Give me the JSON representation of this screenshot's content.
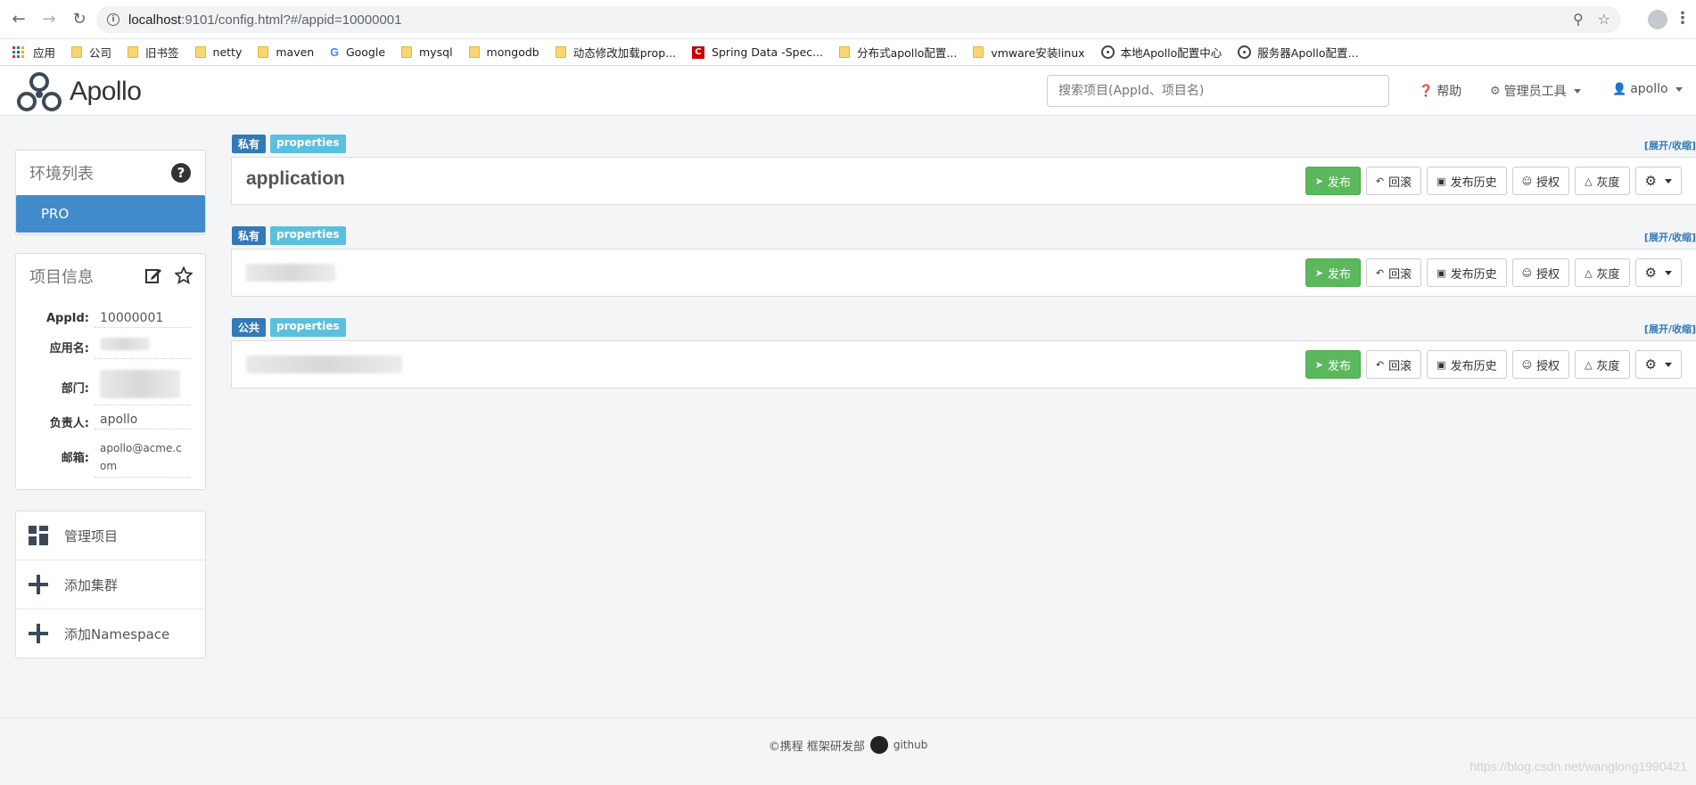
{
  "browser": {
    "url_host": "localhost",
    "url_rest": ":9101/config.html?#/appid=10000001",
    "bookmarks": [
      {
        "label": "应用",
        "icon": "apps-icon"
      },
      {
        "label": "公司",
        "icon": "folder-icon"
      },
      {
        "label": "旧书签",
        "icon": "folder-icon"
      },
      {
        "label": "netty",
        "icon": "folder-icon"
      },
      {
        "label": "maven",
        "icon": "folder-icon"
      },
      {
        "label": "Google",
        "icon": "google-icon"
      },
      {
        "label": "mysql",
        "icon": "folder-icon"
      },
      {
        "label": "mongodb",
        "icon": "folder-icon"
      },
      {
        "label": "动态修改加载prop...",
        "icon": "folder-icon"
      },
      {
        "label": "Spring Data -Spec...",
        "icon": "spring-icon"
      },
      {
        "label": "分布式apollo配置...",
        "icon": "folder-icon"
      },
      {
        "label": "vmware安装linux",
        "icon": "folder-icon"
      },
      {
        "label": "本地Apollo配置中心",
        "icon": "apollo-icon"
      },
      {
        "label": "服务器Apollo配置...",
        "icon": "apollo-icon"
      }
    ]
  },
  "header": {
    "logo_text": "Apollo",
    "search_placeholder": "搜索项目(AppId、项目名)",
    "help": "帮助",
    "admin_tools": "管理员工具",
    "user": "apollo"
  },
  "env_panel": {
    "title": "环境列表",
    "envs": [
      "PRO"
    ]
  },
  "project_info": {
    "title": "项目信息",
    "rows": [
      {
        "label": "AppId:",
        "value": "10000001"
      },
      {
        "label": "应用名:",
        "value": ""
      },
      {
        "label": "部门:",
        "value": ""
      },
      {
        "label": "负责人:",
        "value": "apollo"
      },
      {
        "label": "邮箱:",
        "value": "apollo@acme.com"
      }
    ]
  },
  "side_menu": [
    {
      "label": "管理项目",
      "icon": "dashboard-icon"
    },
    {
      "label": "添加集群",
      "icon": "plus-icon"
    },
    {
      "label": "添加Namespace",
      "icon": "plus-icon"
    }
  ],
  "namespaces": [
    {
      "scope": "私有",
      "format": "properties",
      "name": "application"
    },
    {
      "scope": "私有",
      "format": "properties",
      "name": ""
    },
    {
      "scope": "公共",
      "format": "properties",
      "name": ""
    }
  ],
  "expand_label": "[展开/收缩]",
  "ns_buttons": {
    "publish": "发布",
    "rollback": "回滚",
    "history": "发布历史",
    "grant": "授权",
    "gray": "灰度"
  },
  "footer": {
    "company": "©携程 框架研发部",
    "github": "github"
  },
  "watermark": "https://blog.csdn.net/wanglong1990421"
}
